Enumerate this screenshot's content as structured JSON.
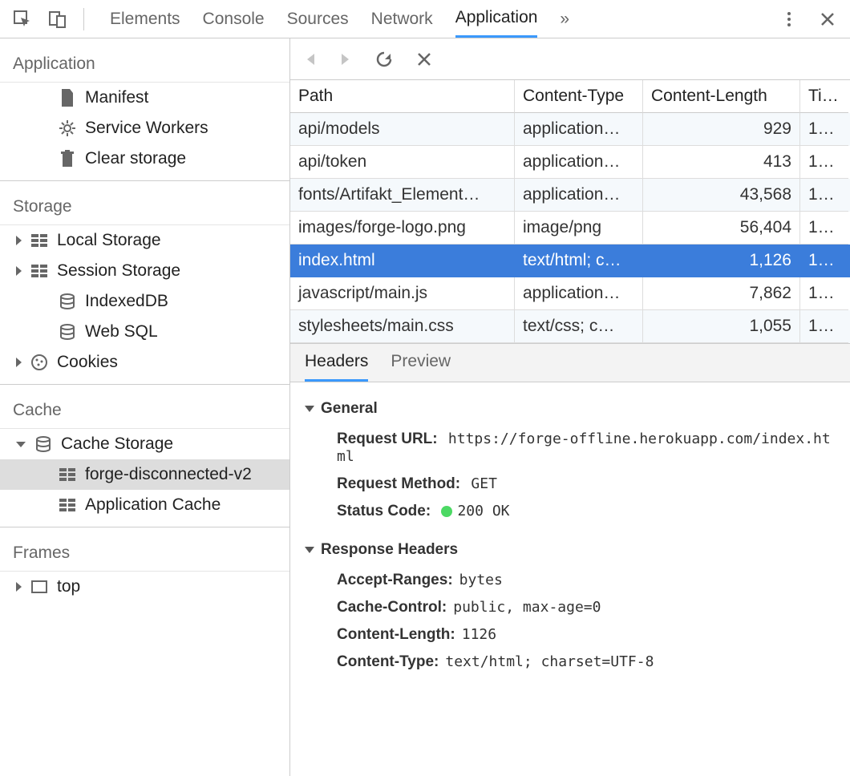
{
  "tabs": {
    "elements": "Elements",
    "console": "Console",
    "sources": "Sources",
    "network": "Network",
    "application": "Application",
    "more": "»"
  },
  "active_tab": "application",
  "sidebar": {
    "sections": [
      {
        "title": "Application",
        "items": [
          {
            "label": "Manifest",
            "icon": "file"
          },
          {
            "label": "Service Workers",
            "icon": "gear"
          },
          {
            "label": "Clear storage",
            "icon": "trash"
          }
        ]
      },
      {
        "title": "Storage",
        "items": [
          {
            "label": "Local Storage",
            "icon": "grid",
            "expandable": true
          },
          {
            "label": "Session Storage",
            "icon": "grid",
            "expandable": true
          },
          {
            "label": "IndexedDB",
            "icon": "db"
          },
          {
            "label": "Web SQL",
            "icon": "db"
          },
          {
            "label": "Cookies",
            "icon": "cookie",
            "expandable": true
          }
        ]
      },
      {
        "title": "Cache",
        "items": [
          {
            "label": "Cache Storage",
            "icon": "db",
            "expandable": true,
            "expanded": true,
            "children": [
              {
                "label": "forge-disconnected-v2",
                "icon": "grid",
                "selected": true
              }
            ]
          },
          {
            "label": "Application Cache",
            "icon": "grid"
          }
        ]
      },
      {
        "title": "Frames",
        "items": [
          {
            "label": "top",
            "icon": "frame",
            "expandable": true
          }
        ]
      }
    ]
  },
  "table": {
    "columns": [
      "Path",
      "Content-Type",
      "Content-Length",
      "Ti…"
    ],
    "rows": [
      {
        "path": "api/models",
        "type": "application…",
        "length": "929",
        "time": "1…"
      },
      {
        "path": "api/token",
        "type": "application…",
        "length": "413",
        "time": "1…"
      },
      {
        "path": "fonts/Artifakt_Element…",
        "type": "application…",
        "length": "43,568",
        "time": "1…"
      },
      {
        "path": "images/forge-logo.png",
        "type": "image/png",
        "length": "56,404",
        "time": "1…"
      },
      {
        "path": "index.html",
        "type": "text/html; c…",
        "length": "1,126",
        "time": "1…",
        "selected": true
      },
      {
        "path": "javascript/main.js",
        "type": "application…",
        "length": "7,862",
        "time": "1…"
      },
      {
        "path": "stylesheets/main.css",
        "type": "text/css; c…",
        "length": "1,055",
        "time": "1…"
      }
    ]
  },
  "detail": {
    "tabs": {
      "headers": "Headers",
      "preview": "Preview"
    },
    "active_tab": "headers",
    "general_title": "General",
    "general": {
      "request_url_label": "Request URL:",
      "request_url": "https://forge-offline.herokuapp.com/index.html",
      "request_method_label": "Request Method:",
      "request_method": "GET",
      "status_code_label": "Status Code:",
      "status_code": "200 OK"
    },
    "response_headers_title": "Response Headers",
    "response_headers": [
      {
        "k": "Accept-Ranges:",
        "v": "bytes"
      },
      {
        "k": "Cache-Control:",
        "v": "public, max-age=0"
      },
      {
        "k": "Content-Length:",
        "v": "1126"
      },
      {
        "k": "Content-Type:",
        "v": "text/html; charset=UTF-8"
      }
    ]
  }
}
